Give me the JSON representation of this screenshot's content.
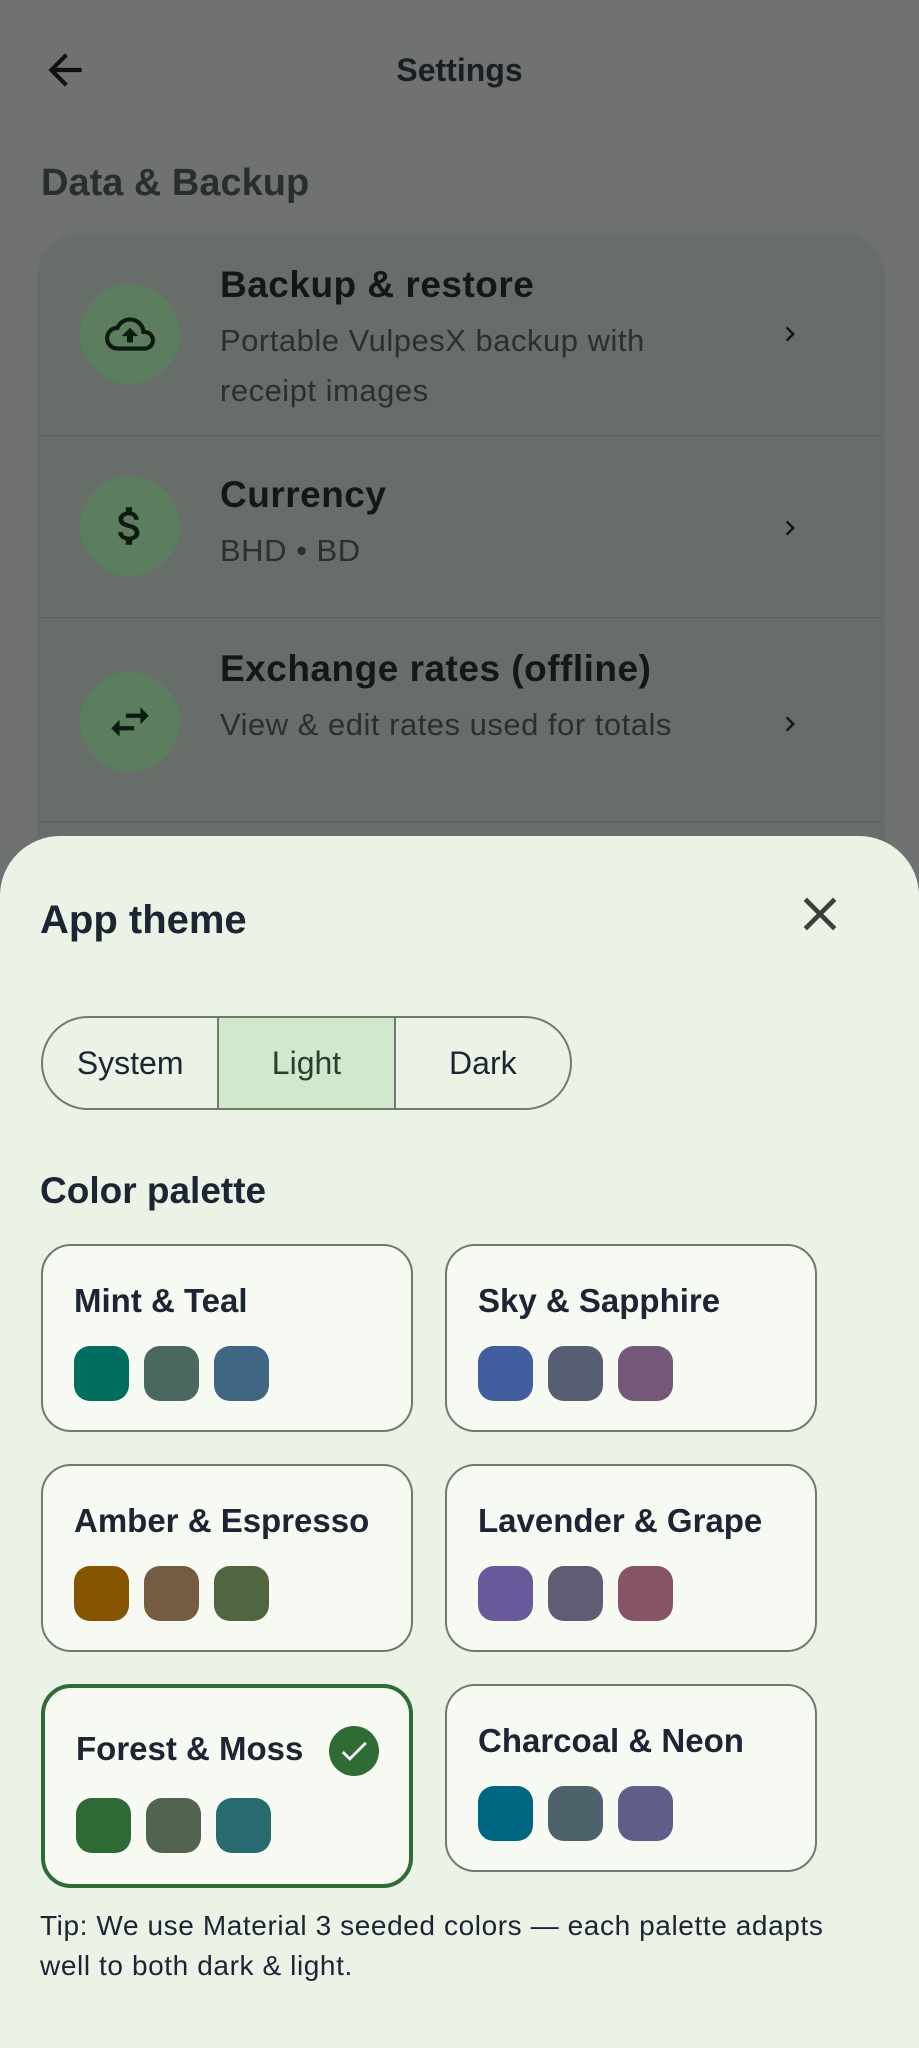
{
  "header": {
    "title": "Settings"
  },
  "section": {
    "title": "Data & Backup"
  },
  "rows": [
    {
      "title": "Backup & restore",
      "subtitle": "Portable VulpesX backup with receipt images",
      "icon": "cloud-upload-icon"
    },
    {
      "title": "Currency",
      "subtitle": "BHD  •  BD",
      "icon": "dollar-icon"
    },
    {
      "title": "Exchange rates (offline)",
      "subtitle": "View & edit rates used for totals",
      "icon": "swap-icon"
    }
  ],
  "sheet": {
    "title": "App theme",
    "modes": [
      "System",
      "Light",
      "Dark"
    ],
    "selected_mode": "Light",
    "palette_title": "Color palette",
    "palettes": [
      {
        "name": "Mint & Teal",
        "colors": [
          "#006e5e",
          "#4a6760",
          "#3f6683"
        ],
        "selected": false
      },
      {
        "name": "Sky & Sapphire",
        "colors": [
          "#415f9e",
          "#575e74",
          "#75577a"
        ],
        "selected": false
      },
      {
        "name": "Amber & Espresso",
        "colors": [
          "#845400",
          "#755b41",
          "#4f6640"
        ],
        "selected": false
      },
      {
        "name": "Lavender & Grape",
        "colors": [
          "#6a5a9c",
          "#625b74",
          "#875367"
        ],
        "selected": false
      },
      {
        "name": "Forest & Moss",
        "colors": [
          "#2c6b33",
          "#52634f",
          "#276a70"
        ],
        "selected": true
      },
      {
        "name": "Charcoal & Neon",
        "colors": [
          "#006782",
          "#4d626b",
          "#5f5d8a"
        ],
        "selected": false
      }
    ],
    "tip": "Tip: We use Material 3 seeded colors — each palette adapts well to both dark & light."
  }
}
